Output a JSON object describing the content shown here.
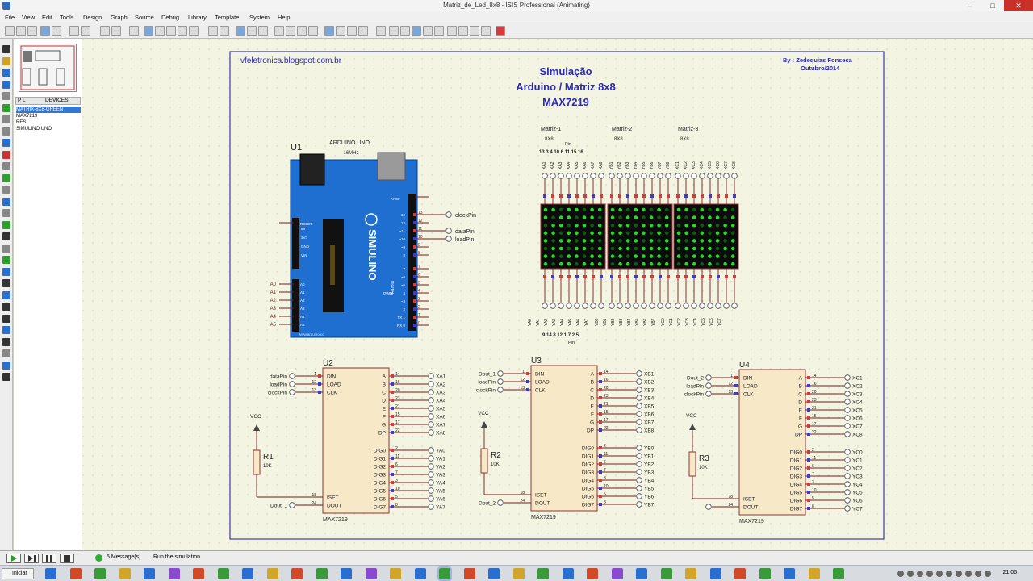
{
  "window": {
    "title": "Matriz_de_Led_8x8 - ISIS Professional (Animating)"
  },
  "menu": [
    "File",
    "View",
    "Edit",
    "Tools",
    "Design",
    "Graph",
    "Source",
    "Debug",
    "Library",
    "Template",
    "System",
    "Help"
  ],
  "device_panel": {
    "mode_label": "P",
    "tab_label": "L",
    "header_label": "DEVICES",
    "devices": [
      "MATRIX-8X8-GREEN",
      "MAX7219",
      "RES",
      "SIMULINO UNO"
    ],
    "selected_index": 0
  },
  "schematic": {
    "site": "vfeletronica.blogspot.com.br",
    "title_lines": [
      "Simulação",
      "Arduino / Matriz 8x8",
      "MAX7219"
    ],
    "author_lines": [
      "By : Zedequias Fonseca",
      "Outubro/2014"
    ],
    "arduino": {
      "ref": "U1",
      "model": "ARDUINO UNO",
      "freq": "16MHz",
      "aref": "AREF",
      "reset": "RESET",
      "analog_pins": [
        "A0",
        "A1",
        "A2",
        "A3",
        "A4",
        "A5"
      ],
      "left_power": [
        "5V",
        "3V3",
        "GND",
        "VIN"
      ],
      "digital_top": [
        "13",
        "12",
        "~11",
        "~10",
        "~9",
        "8"
      ],
      "digital_bottom": [
        "7",
        "~6",
        "~5",
        "4",
        "~3",
        "2",
        "TX 1",
        "RX 0"
      ],
      "section_labels": [
        "PWM",
        "DIGITAL"
      ],
      "brand": "SIMULINO",
      "site_small": "www.arduino.cc",
      "nets": [
        "clockPin",
        "dataPin",
        "loadPin"
      ]
    },
    "matrix": {
      "labels": [
        "Matriz-1",
        "Matriz-2",
        "Matriz-3"
      ],
      "size_label": "8X8",
      "pin_label": "Pin",
      "top_pins": "13 3 4 10 6 11 15 16",
      "bottom_pins": "9 14 8 12 1 7 2 5",
      "bottom_pin_label": "Pin",
      "col_prefixes": [
        "XA",
        "YB",
        "XC"
      ]
    },
    "max_chips": [
      {
        "ref": "U2",
        "part": "MAX7219",
        "inputs": [
          {
            "pin": "1",
            "name": "DIN",
            "net": "dataPin"
          },
          {
            "pin": "12",
            "name": "LOAD",
            "net": "loadPin"
          },
          {
            "pin": "13",
            "name": "CLK",
            "net": "clockPin"
          }
        ],
        "seg_pins": [
          "14",
          "16",
          "20",
          "23",
          "21",
          "15",
          "17",
          "22"
        ],
        "seg_names": [
          "A",
          "B",
          "C",
          "D",
          "E",
          "F",
          "G",
          "DP"
        ],
        "seg_nets": [
          "XA1",
          "XA2",
          "XA3",
          "XA4",
          "XA5",
          "XA6",
          "XA7",
          "XA8"
        ],
        "dig_pins": [
          "2",
          "11",
          "6",
          "7",
          "3",
          "10",
          "5",
          "8"
        ],
        "dig_names": [
          "DIG0",
          "DIG1",
          "DIG2",
          "DIG3",
          "DIG4",
          "DIG5",
          "DIG6",
          "DIG7"
        ],
        "dig_nets": [
          "YA0",
          "YA1",
          "YA2",
          "YA3",
          "YA4",
          "YA5",
          "YA6",
          "YA7"
        ],
        "iset_pin": "18",
        "iset": "ISET",
        "dout_pin": "24",
        "dout": "DOUT",
        "dout_net": "Dout_1",
        "res_ref": "R1",
        "res_val": "10K",
        "vcc": "VCC"
      },
      {
        "ref": "U3",
        "part": "MAX7219",
        "inputs": [
          {
            "pin": "1",
            "name": "DIN",
            "net": "Dout_1"
          },
          {
            "pin": "12",
            "name": "LOAD",
            "net": "loadPin"
          },
          {
            "pin": "13",
            "name": "CLK",
            "net": "clockPin"
          }
        ],
        "seg_pins": [
          "14",
          "16",
          "20",
          "23",
          "21",
          "15",
          "17",
          "22"
        ],
        "seg_names": [
          "A",
          "B",
          "C",
          "D",
          "E",
          "F",
          "G",
          "DP"
        ],
        "seg_nets": [
          "XB1",
          "XB2",
          "XB3",
          "XB4",
          "XB5",
          "XB6",
          "XB7",
          "XB8"
        ],
        "dig_pins": [
          "2",
          "11",
          "6",
          "7",
          "3",
          "10",
          "5",
          "8"
        ],
        "dig_names": [
          "DIG0",
          "DIG1",
          "DIG2",
          "DIG3",
          "DIG4",
          "DIG5",
          "DIG6",
          "DIG7"
        ],
        "dig_nets": [
          "YB0",
          "YB1",
          "YB2",
          "YB3",
          "YB4",
          "YB5",
          "YB6",
          "YB7"
        ],
        "iset_pin": "18",
        "iset": "ISET",
        "dout_pin": "24",
        "dout": "DOUT",
        "dout_net": "Dout_2",
        "res_ref": "R2",
        "res_val": "10K",
        "vcc": "VCC"
      },
      {
        "ref": "U4",
        "part": "MAX7219",
        "inputs": [
          {
            "pin": "1",
            "name": "DIN",
            "net": "Dout_2"
          },
          {
            "pin": "12",
            "name": "LOAD",
            "net": "loadPin"
          },
          {
            "pin": "13",
            "name": "CLK",
            "net": "clockPin"
          }
        ],
        "seg_pins": [
          "14",
          "16",
          "20",
          "23",
          "21",
          "15",
          "17",
          "22"
        ],
        "seg_names": [
          "A",
          "B",
          "C",
          "D",
          "E",
          "F",
          "G",
          "DP"
        ],
        "seg_nets": [
          "XC1",
          "XC2",
          "XC3",
          "XC4",
          "XC5",
          "XC6",
          "XC7",
          "XC8"
        ],
        "dig_pins": [
          "2",
          "11",
          "6",
          "7",
          "3",
          "10",
          "5",
          "8"
        ],
        "dig_names": [
          "DIG0",
          "DIG1",
          "DIG2",
          "DIG3",
          "DIG4",
          "DIG5",
          "DIG6",
          "DIG7"
        ],
        "dig_nets": [
          "YC0",
          "YC1",
          "YC2",
          "YC3",
          "YC4",
          "YC5",
          "YC6",
          "YC7"
        ],
        "iset_pin": "18",
        "iset": "ISET",
        "dout_pin": "24",
        "dout": "DOUT",
        "dout_net": "",
        "res_ref": "R3",
        "res_val": "10K",
        "vcc": "VCC"
      }
    ]
  },
  "status": {
    "messages": "5 Message(s)",
    "hint": "Run the simulation"
  },
  "taskbar": {
    "start": "Iniciar",
    "time": "21:06"
  },
  "colors": {
    "board": "#1f6fd0",
    "led_on": "#22dd22",
    "led_off": "#0f5a12",
    "wire": "#7a1a1a",
    "frame": "#3939a8",
    "title_blue": "#2a2ab8"
  }
}
